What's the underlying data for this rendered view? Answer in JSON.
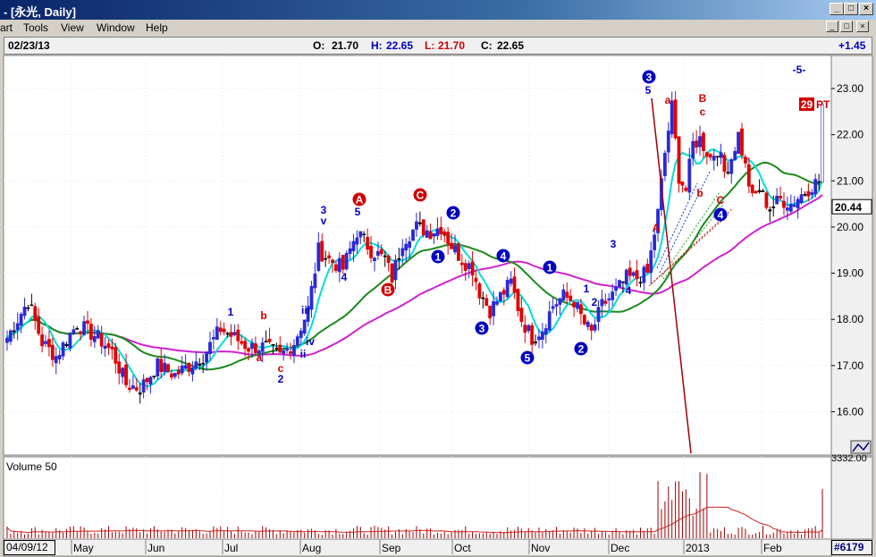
{
  "window": {
    "title": "- [永光, Daily]",
    "buttons": [
      "_",
      "□",
      "×"
    ]
  },
  "menu": {
    "items": [
      "art",
      "Tools",
      "View",
      "Window",
      "Help"
    ],
    "mdi_buttons": [
      "_",
      "□",
      "×"
    ]
  },
  "quote": {
    "date": "02/23/13",
    "open_label": "O:",
    "open": "21.70",
    "high_label": "H:",
    "high": "22.65",
    "low_label": "L:",
    "low": "21.70",
    "close_label": "C:",
    "close": "22.65",
    "change": "+1.45"
  },
  "footer": {
    "start_date": "04/09/12",
    "code": "#6179"
  },
  "colors": {
    "up": "#2a2ad8",
    "down": "#e00000",
    "neutral": "#000000",
    "ma_fast": "#00dddd",
    "ma_mid": "#1a8a1a",
    "ma_slow": "#d020d0",
    "wave_blue": "#0000c0",
    "wave_red": "#d00000",
    "volume": "#a00000"
  },
  "chart_data": [
    {
      "type": "candlestick",
      "x_months": [
        "May",
        "Jun",
        "Jul",
        "Aug",
        "Sep",
        "Oct",
        "Nov",
        "Dec",
        "2013",
        "Feb"
      ],
      "ylim": [
        15.0,
        23.6
      ],
      "yticks": [
        "23.00",
        "22.00",
        "21.00",
        "20.00",
        "19.00",
        "18.00",
        "17.00",
        "16.00"
      ],
      "last_price": "20.44",
      "pt_badge": "29",
      "pt_label": "PT",
      "top_label": "-5-",
      "price_waypoints": [
        [
          0,
          17.6
        ],
        [
          6,
          18.4
        ],
        [
          10,
          17.5
        ],
        [
          14,
          17.2
        ],
        [
          20,
          17.9
        ],
        [
          26,
          17.6
        ],
        [
          30,
          17.3
        ],
        [
          34,
          16.6
        ],
        [
          38,
          16.5
        ],
        [
          43,
          17.0
        ],
        [
          48,
          16.8
        ],
        [
          52,
          17.0
        ],
        [
          56,
          17.2
        ],
        [
          61,
          17.8
        ],
        [
          65,
          17.6
        ],
        [
          69,
          17.4
        ],
        [
          74,
          17.4
        ],
        [
          78,
          17.2
        ],
        [
          82,
          17.5
        ],
        [
          86,
          18.2
        ],
        [
          89,
          19.5
        ],
        [
          92,
          19.3
        ],
        [
          96,
          19.1
        ],
        [
          100,
          19.9
        ],
        [
          104,
          19.5
        ],
        [
          108,
          19.3
        ],
        [
          110,
          18.9
        ],
        [
          113,
          19.7
        ],
        [
          117,
          20.0
        ],
        [
          121,
          19.9
        ],
        [
          124,
          20.0
        ],
        [
          127,
          19.6
        ],
        [
          130,
          19.3
        ],
        [
          133,
          19.1
        ],
        [
          135,
          18.6
        ],
        [
          138,
          18.2
        ],
        [
          141,
          18.5
        ],
        [
          144,
          18.8
        ],
        [
          147,
          18.0
        ],
        [
          150,
          17.6
        ],
        [
          153,
          17.8
        ],
        [
          156,
          18.3
        ],
        [
          159,
          18.5
        ],
        [
          162,
          18.4
        ],
        [
          165,
          17.9
        ],
        [
          167,
          17.7
        ],
        [
          170,
          18.3
        ],
        [
          174,
          18.6
        ],
        [
          177,
          18.9
        ],
        [
          180,
          18.9
        ],
        [
          183,
          19.0
        ],
        [
          186,
          20.3
        ],
        [
          188,
          21.6
        ],
        [
          190,
          22.6
        ],
        [
          192,
          21.1
        ],
        [
          194,
          20.8
        ],
        [
          196,
          21.8
        ],
        [
          198,
          21.9
        ],
        [
          201,
          21.5
        ],
        [
          203,
          21.7
        ],
        [
          205,
          21.2
        ],
        [
          207,
          21.5
        ],
        [
          209,
          22.0
        ],
        [
          211,
          21.3
        ],
        [
          213,
          20.6
        ],
        [
          215,
          20.8
        ],
        [
          218,
          20.4
        ],
        [
          221,
          20.6
        ],
        [
          224,
          20.5
        ],
        [
          227,
          20.7
        ],
        [
          230,
          20.9
        ],
        [
          232,
          21.0
        ],
        [
          233,
          22.65
        ]
      ],
      "volume_label": "Volume 50",
      "volume_axis_label": "3332.00",
      "volume_ma": true,
      "moving_averages": [
        "fast",
        "mid",
        "slow"
      ],
      "wave_labels_blue_circled": [
        "2",
        "1",
        "4",
        "3",
        "5",
        "1",
        "2",
        "3",
        "4"
      ],
      "wave_labels_red_circled": [
        "A",
        "B",
        "C"
      ],
      "wave_text_blue": [
        "1",
        "2",
        "3",
        "v",
        "4",
        "5",
        "iii",
        "iv",
        "ii",
        "1",
        "2",
        "3",
        "4",
        "5"
      ],
      "wave_text_red": [
        "a",
        "b",
        "c",
        "a",
        "b",
        "c",
        "B",
        "A",
        "C"
      ]
    }
  ]
}
